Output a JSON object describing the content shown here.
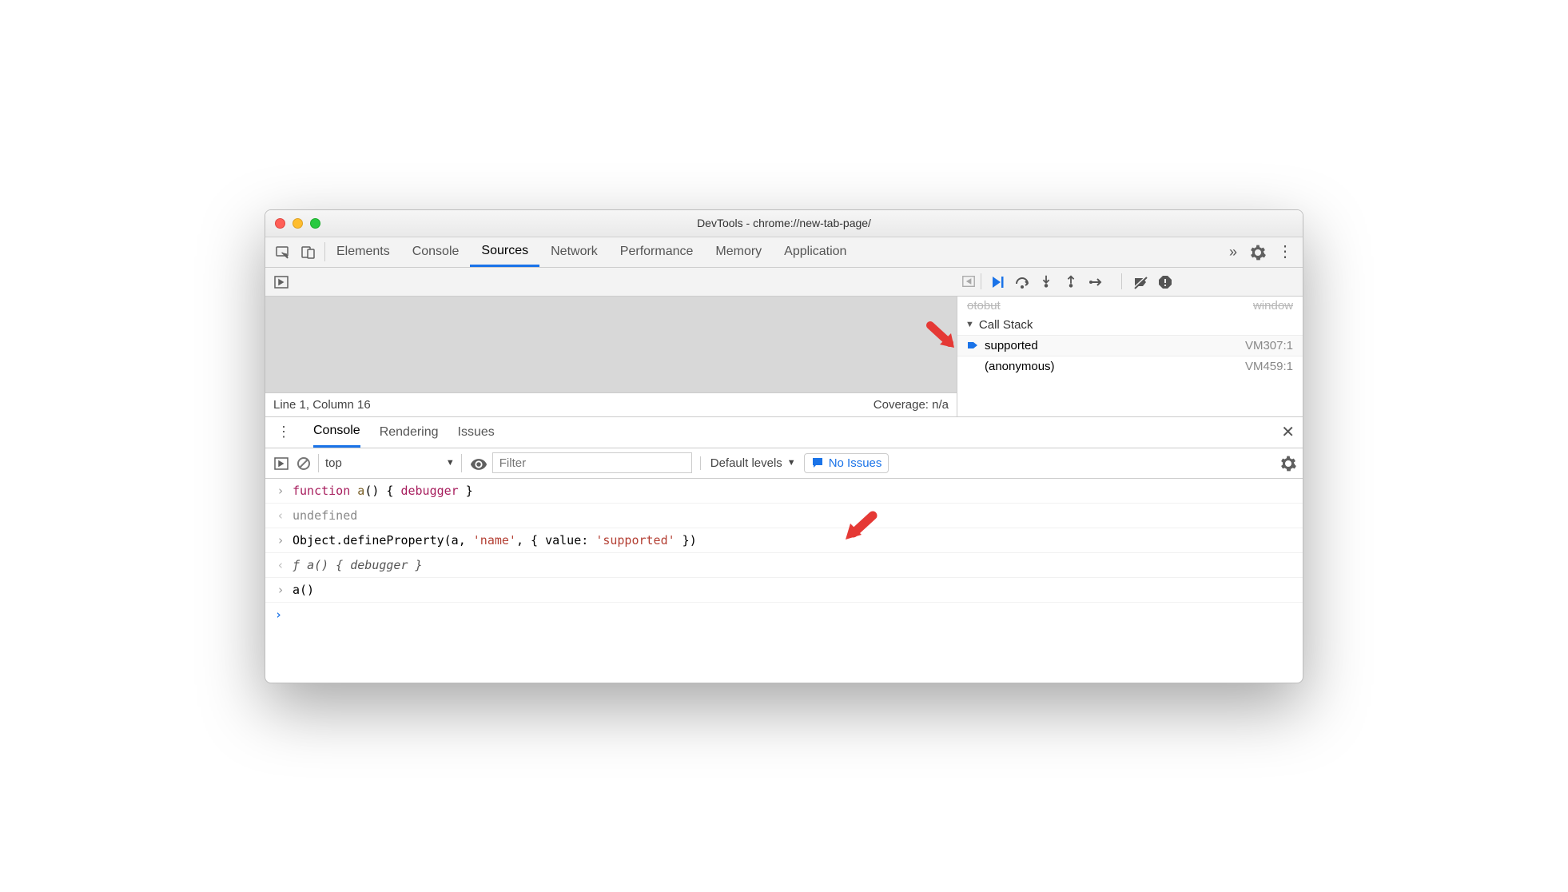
{
  "window": {
    "title": "DevTools - chrome://new-tab-page/"
  },
  "main_tabs": {
    "items": [
      "Elements",
      "Console",
      "Sources",
      "Network",
      "Performance",
      "Memory",
      "Application"
    ],
    "active_index": 2
  },
  "debugger": {
    "call_stack_header": "Call Stack",
    "frames": [
      {
        "name": "supported",
        "location": "VM307:1",
        "current": true
      },
      {
        "name": "(anonymous)",
        "location": "VM459:1",
        "current": false
      }
    ]
  },
  "source_status": {
    "position": "Line 1, Column 16",
    "coverage": "Coverage: n/a"
  },
  "drawer": {
    "tabs": [
      "Console",
      "Rendering",
      "Issues"
    ],
    "active_index": 0
  },
  "console_toolbar": {
    "context": "top",
    "filter_placeholder": "Filter",
    "levels": "Default levels",
    "issues": "No Issues"
  },
  "console_lines": {
    "l1_kw1": "function",
    "l1_name": "a",
    "l1_kw2": "debugger",
    "l2": "undefined",
    "l3_obj": "Object.defineProperty(a, ",
    "l3_s1": "'name'",
    "l3_mid": ", { value: ",
    "l3_s2": "'supported'",
    "l3_end": " })",
    "l4_pre": "ƒ ",
    "l4_body": "a() { debugger }",
    "l5": "a()"
  }
}
